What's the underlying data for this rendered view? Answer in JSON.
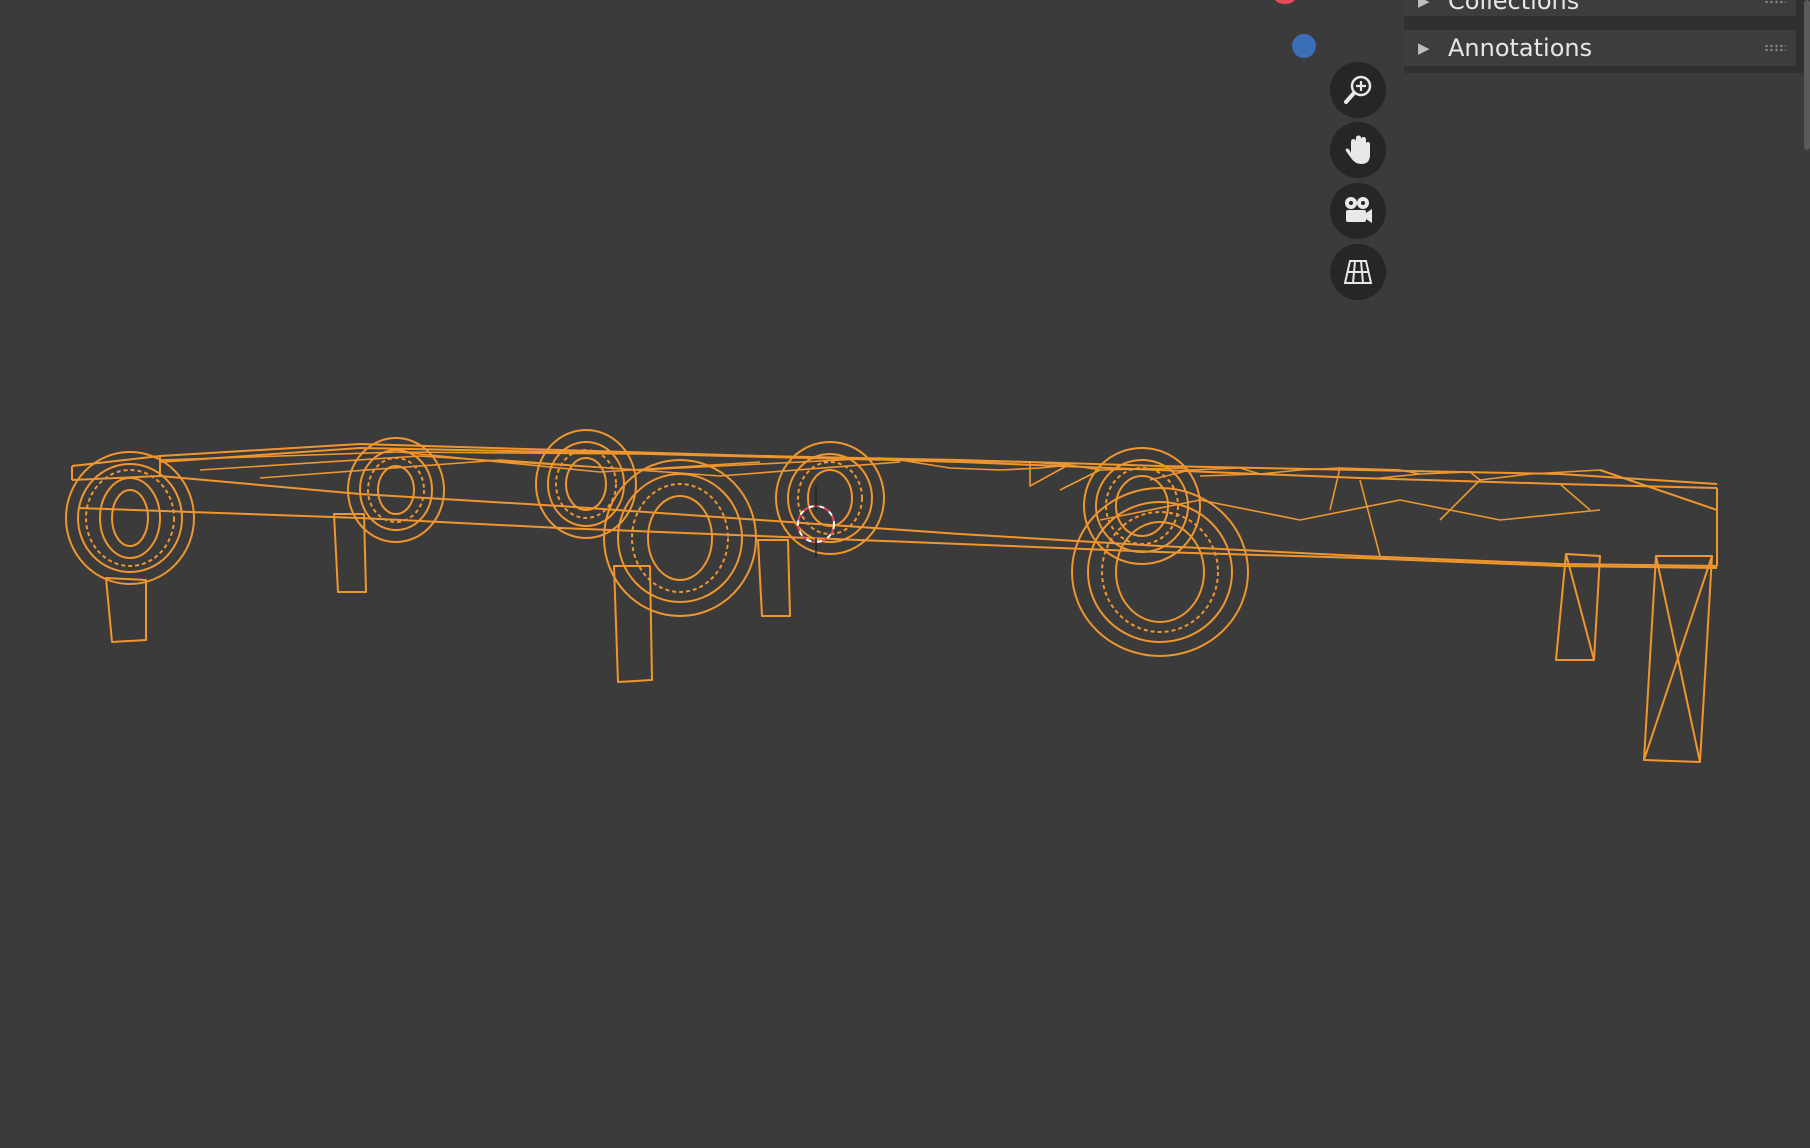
{
  "sidebar": {
    "panels": [
      {
        "label": "Collections",
        "arrow": "▶"
      },
      {
        "label": "Annotations",
        "arrow": "▶"
      }
    ]
  },
  "navigation": {
    "buttons": [
      {
        "name": "zoom",
        "icon": "zoom-in-icon"
      },
      {
        "name": "pan",
        "icon": "hand-icon"
      },
      {
        "name": "camera",
        "icon": "camera-icon"
      },
      {
        "name": "perspective-toggle",
        "icon": "grid-icon"
      }
    ]
  },
  "gizmo": {
    "x_axis_color": "#e44a5a",
    "y_axis_color": "#3a6fb5"
  },
  "theme": {
    "viewport_bg": "#3b3b3b",
    "wireframe_color": "#f0962e",
    "panel_bg": "#3d3d3d"
  }
}
